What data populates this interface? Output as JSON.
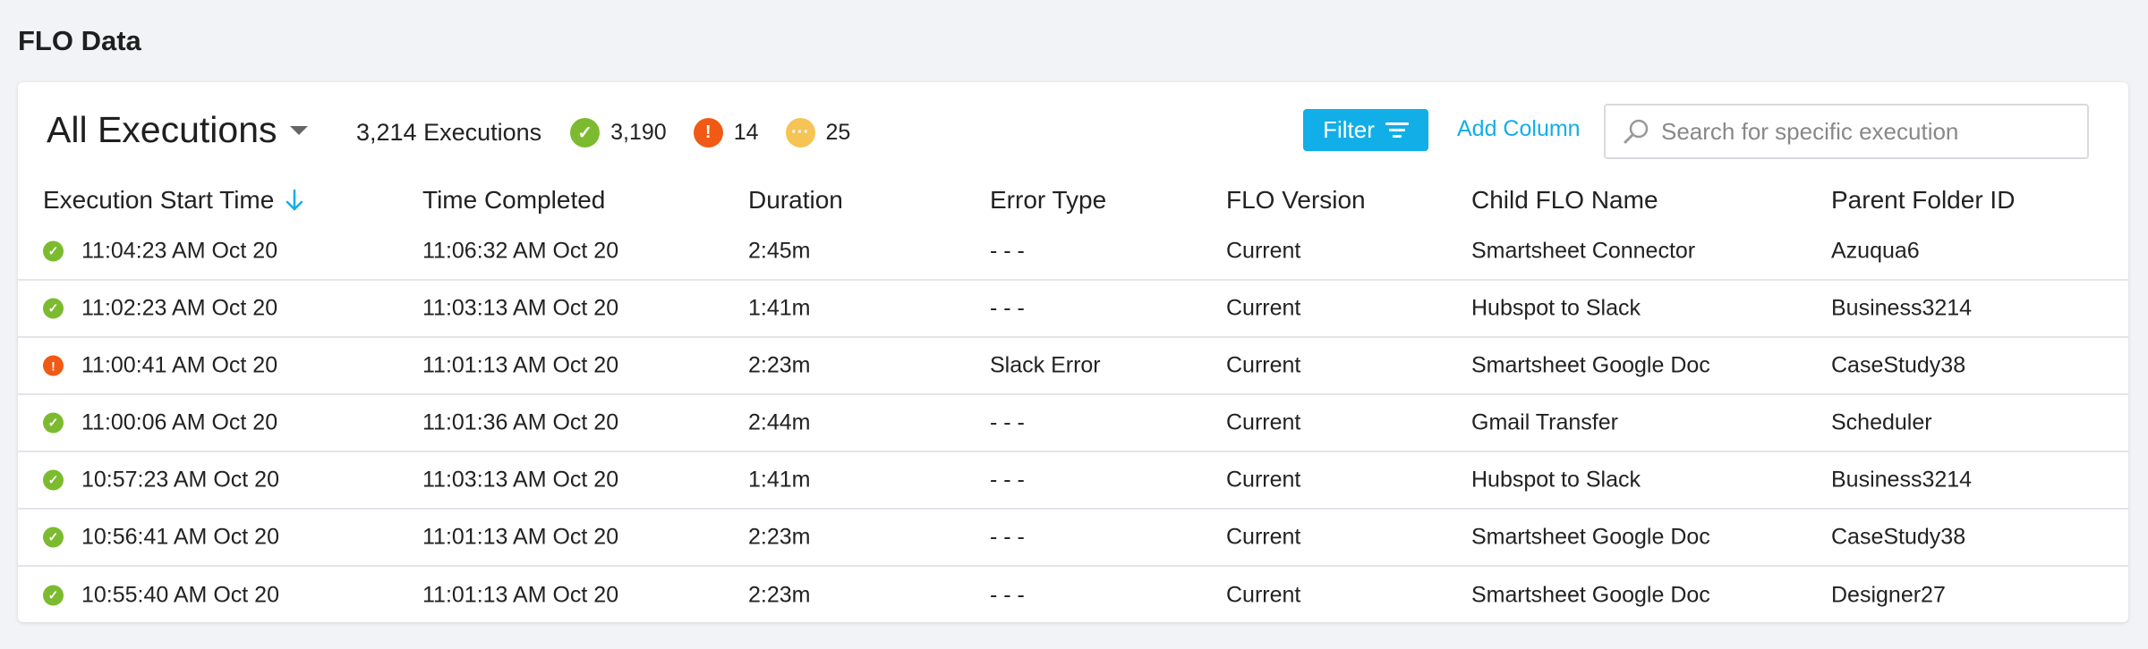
{
  "page": {
    "title": "FLO Data"
  },
  "view": {
    "title": "All Executions"
  },
  "summary": {
    "total": "3,214 Executions",
    "success": "3,190",
    "error": "14",
    "pending": "25"
  },
  "toolbar": {
    "filter_label": "Filter",
    "add_column_label": "Add Column",
    "search_placeholder": "Search for specific execution"
  },
  "columns": [
    "Execution Start Time",
    "Time Completed",
    "Duration",
    "Error Type",
    "FLO Version",
    "Child FLO Name",
    "Parent Folder ID"
  ],
  "rows": [
    {
      "status": "success",
      "start": "11:04:23 AM Oct 20",
      "completed": "11:06:32 AM Oct 20",
      "duration": "2:45m",
      "error": "- - -",
      "version": "Current",
      "child": "Smartsheet Connector",
      "folder": "Azuqua6"
    },
    {
      "status": "success",
      "start": "11:02:23 AM Oct 20",
      "completed": "11:03:13 AM Oct 20",
      "duration": "1:41m",
      "error": "- - -",
      "version": "Current",
      "child": "Hubspot to Slack",
      "folder": "Business3214"
    },
    {
      "status": "error",
      "start": "11:00:41 AM Oct 20",
      "completed": "11:01:13 AM Oct 20",
      "duration": "2:23m",
      "error": "Slack Error",
      "version": "Current",
      "child": "Smartsheet Google Doc",
      "folder": "CaseStudy38"
    },
    {
      "status": "success",
      "start": "11:00:06 AM Oct 20",
      "completed": "11:01:36 AM Oct 20",
      "duration": "2:44m",
      "error": "- - -",
      "version": "Current",
      "child": "Gmail Transfer",
      "folder": "Scheduler"
    },
    {
      "status": "success",
      "start": "10:57:23 AM Oct 20",
      "completed": "11:03:13 AM Oct 20",
      "duration": "1:41m",
      "error": "- - -",
      "version": "Current",
      "child": "Hubspot to Slack",
      "folder": "Business3214"
    },
    {
      "status": "success",
      "start": "10:56:41 AM Oct 20",
      "completed": "11:01:13 AM Oct 20",
      "duration": "2:23m",
      "error": "- - -",
      "version": "Current",
      "child": "Smartsheet Google Doc",
      "folder": "CaseStudy38"
    },
    {
      "status": "success",
      "start": "10:55:40 AM Oct 20",
      "completed": "11:01:13 AM Oct 20",
      "duration": "2:23m",
      "error": "- - -",
      "version": "Current",
      "child": "Smartsheet Google Doc",
      "folder": "Designer27"
    }
  ],
  "icons": {
    "success": "check-circle-icon",
    "error": "exclamation-circle-icon",
    "pending": "ellipsis-circle-icon",
    "sort": "arrow-down-icon",
    "search": "search-icon",
    "filter": "filter-icon"
  },
  "colors": {
    "accent": "#11aee8",
    "success": "#7cbb2f",
    "error": "#f05a14",
    "pending": "#f6c454"
  }
}
